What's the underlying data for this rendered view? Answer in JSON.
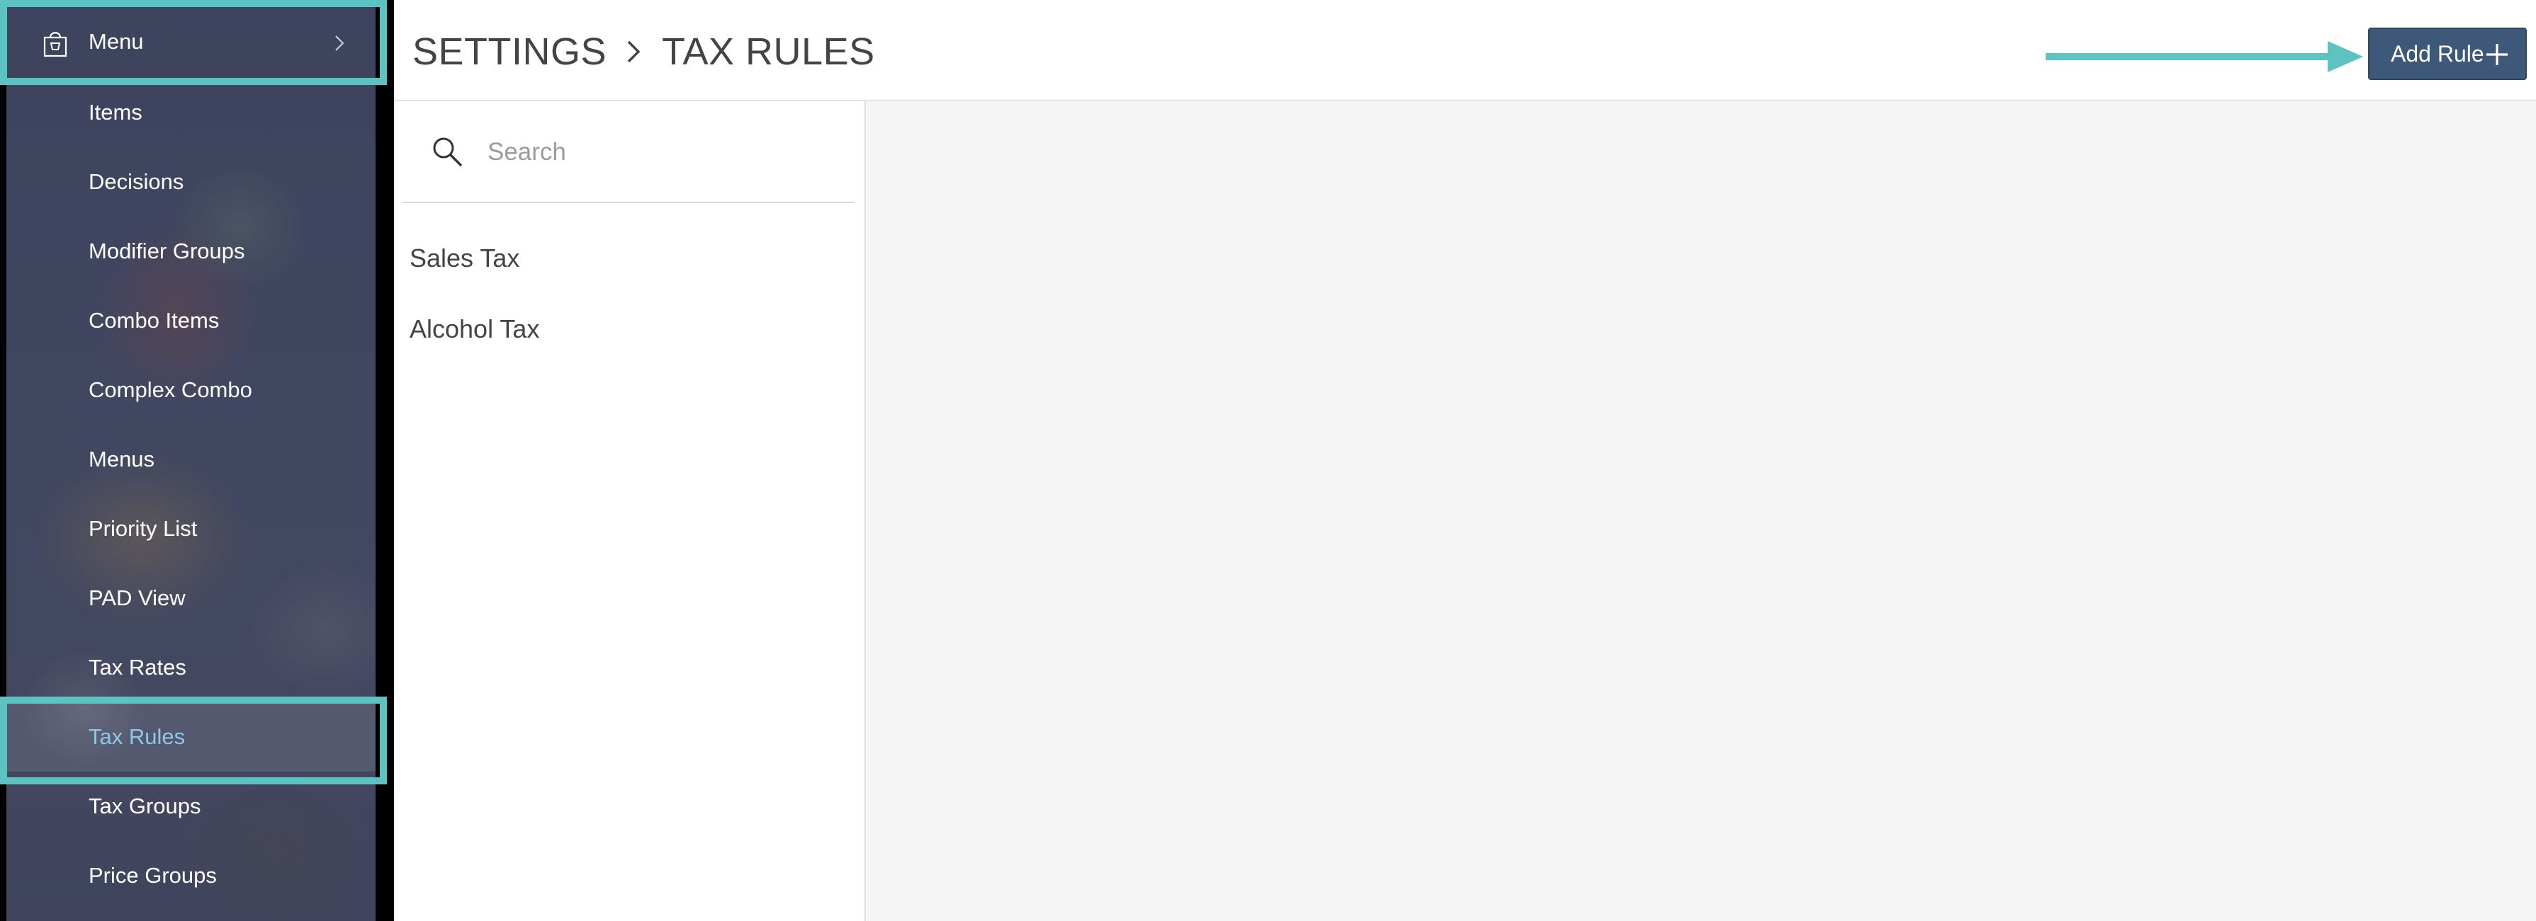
{
  "sidebar": {
    "header_label": "Menu",
    "header_icon": "shopping-bag-icon",
    "items": [
      {
        "label": "Items",
        "active": false
      },
      {
        "label": "Decisions",
        "active": false
      },
      {
        "label": "Modifier Groups",
        "active": false
      },
      {
        "label": "Combo Items",
        "active": false
      },
      {
        "label": "Complex Combo",
        "active": false
      },
      {
        "label": "Menus",
        "active": false
      },
      {
        "label": "Priority List",
        "active": false
      },
      {
        "label": "PAD View",
        "active": false
      },
      {
        "label": "Tax Rates",
        "active": false
      },
      {
        "label": "Tax Rules",
        "active": true
      },
      {
        "label": "Tax Groups",
        "active": false
      },
      {
        "label": "Price Groups",
        "active": false
      }
    ],
    "active_color": "#8fc6ea"
  },
  "header": {
    "breadcrumb": [
      "SETTINGS",
      "TAX RULES"
    ],
    "add_button_label": "Add Rule",
    "add_button_color": "#3d5878"
  },
  "search": {
    "placeholder": "Search",
    "value": ""
  },
  "rules": [
    "Sales Tax",
    "Alcohol Tax"
  ],
  "annotation_color": "#5cc2c2"
}
